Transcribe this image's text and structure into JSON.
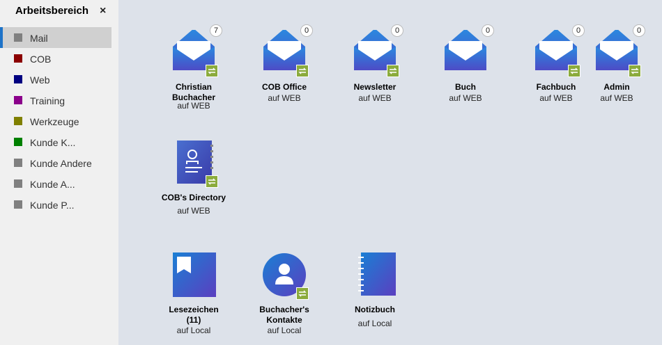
{
  "sidebar": {
    "title": "Arbeitsbereich",
    "close_glyph": "×",
    "items": [
      {
        "label": "Mail",
        "color": "#808080"
      },
      {
        "label": "COB",
        "color": "#8b0000"
      },
      {
        "label": "Web",
        "color": "#000080"
      },
      {
        "label": "Training",
        "color": "#8b008b"
      },
      {
        "label": "Werkzeuge",
        "color": "#808000"
      },
      {
        "label": "Kunde K...",
        "color": "#008000"
      },
      {
        "label": "Kunde Andere",
        "color": "#808080"
      },
      {
        "label": "Kunde A...",
        "color": "#808080"
      },
      {
        "label": "Kunde P...",
        "color": "#808080"
      }
    ]
  },
  "tiles": {
    "mail": [
      {
        "name": "Christian\nBuchacher",
        "sub": "auf WEB",
        "count": "7"
      },
      {
        "name": "COB Office",
        "sub": "auf WEB",
        "count": "0"
      },
      {
        "name": "Newsletter",
        "sub": "auf WEB",
        "count": "0"
      },
      {
        "name": "Buch",
        "sub": "auf WEB",
        "count": "0"
      },
      {
        "name": "Fachbuch",
        "sub": "auf WEB",
        "count": "0"
      },
      {
        "name": "Admin",
        "sub": "auf WEB",
        "count": "0"
      }
    ],
    "directory": {
      "name": "COB's Directory",
      "sub": "auf WEB"
    },
    "bookmarks": {
      "name": "Lesezeichen\n(11)",
      "sub": "auf Local"
    },
    "contacts": {
      "name": "Buchacher's\nKontakte",
      "sub": "auf Local"
    },
    "notebook": {
      "name": "Notizbuch",
      "sub": "auf Local"
    }
  },
  "colors": {
    "accent": "#1e73c8",
    "sync": "#8bab3c"
  }
}
